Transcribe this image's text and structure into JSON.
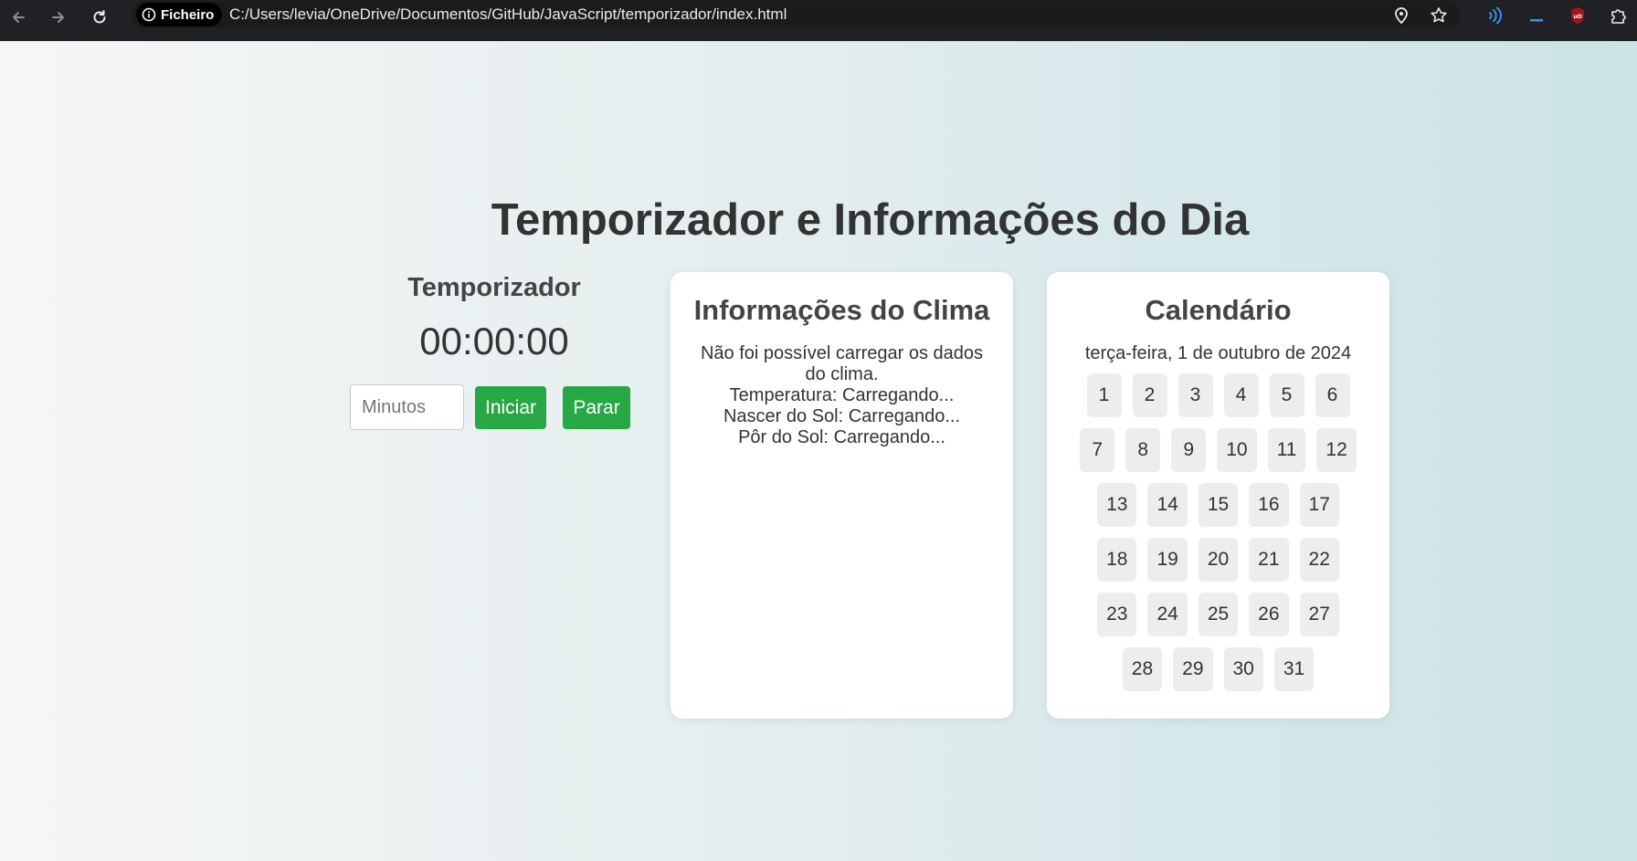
{
  "browser": {
    "chip_label": "Ficheiro",
    "url": "C:/Users/levia/OneDrive/Documentos/GitHub/JavaScript/temporizador/index.html"
  },
  "page": {
    "title": "Temporizador e Informações do Dia"
  },
  "timer": {
    "title": "Temporizador",
    "display": "00:00:00",
    "input_placeholder": "Minutos",
    "start_label": "Iniciar",
    "stop_label": "Parar"
  },
  "weather": {
    "title": "Informações do Clima",
    "error": "Não foi possível carregar os dados do clima.",
    "temperature": "Temperatura: Carregando...",
    "sunrise": "Nascer do Sol: Carregando...",
    "sunset": "Pôr do Sol: Carregando..."
  },
  "calendar": {
    "title": "Calendário",
    "date": "terça-feira, 1 de outubro de 2024",
    "days": [
      "1",
      "2",
      "3",
      "4",
      "5",
      "6",
      "7",
      "8",
      "9",
      "10",
      "11",
      "12",
      "13",
      "14",
      "15",
      "16",
      "17",
      "18",
      "19",
      "20",
      "21",
      "22",
      "23",
      "24",
      "25",
      "26",
      "27",
      "28",
      "29",
      "30",
      "31"
    ]
  },
  "colors": {
    "button": "#28a745",
    "chrome": "#202124",
    "heading": "#333333"
  }
}
